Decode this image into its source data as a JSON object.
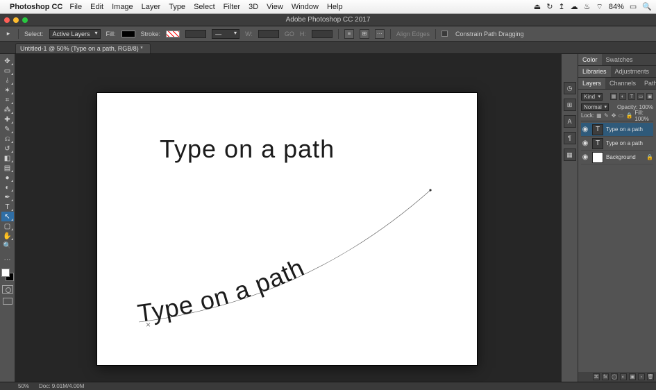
{
  "mac_menubar": {
    "app_name": "Photoshop CC",
    "menus": [
      "File",
      "Edit",
      "Image",
      "Layer",
      "Type",
      "Select",
      "Filter",
      "3D",
      "View",
      "Window",
      "Help"
    ],
    "status": {
      "battery": "84%",
      "icons": [
        "⏏",
        "⟳",
        "↑",
        "☁",
        "🔋",
        "📶"
      ],
      "search": "🔍"
    }
  },
  "app_title": "Adobe Photoshop CC 2017",
  "options_bar": {
    "select_label": "Select:",
    "select_value": "Active Layers",
    "fill_label": "Fill:",
    "stroke_label": "Stroke:",
    "w_label": "W:",
    "h_label": "H:",
    "go_label": "GO",
    "align_label": "Align Edges",
    "constrain_label": "Constrain Path Dragging"
  },
  "doc_tab": "Untitled-1 @ 50% (Type on a path, RGB/8) *",
  "canvas": {
    "straight_text": "Type on a path",
    "curve_text": "Type on a path"
  },
  "panels": {
    "color_tab": "Color",
    "swatches_tab": "Swatches",
    "libraries_tab": "Libraries",
    "adjustments_tab": "Adjustments",
    "layers_tab": "Layers",
    "channels_tab": "Channels",
    "paths_tab": "Paths",
    "kind_label": "Kind",
    "blend_mode": "Normal",
    "opacity_label": "Opacity:",
    "opacity_value": "100%",
    "lock_label": "Lock:",
    "fill_label": "Fill:",
    "fill_value": "100%",
    "layers": [
      {
        "name": "Type on a path"
      },
      {
        "name": "Type on a path"
      },
      {
        "name": "Background"
      }
    ]
  },
  "status": {
    "zoom": "50%",
    "doc_info": "Doc: 9.01M/4.00M"
  }
}
